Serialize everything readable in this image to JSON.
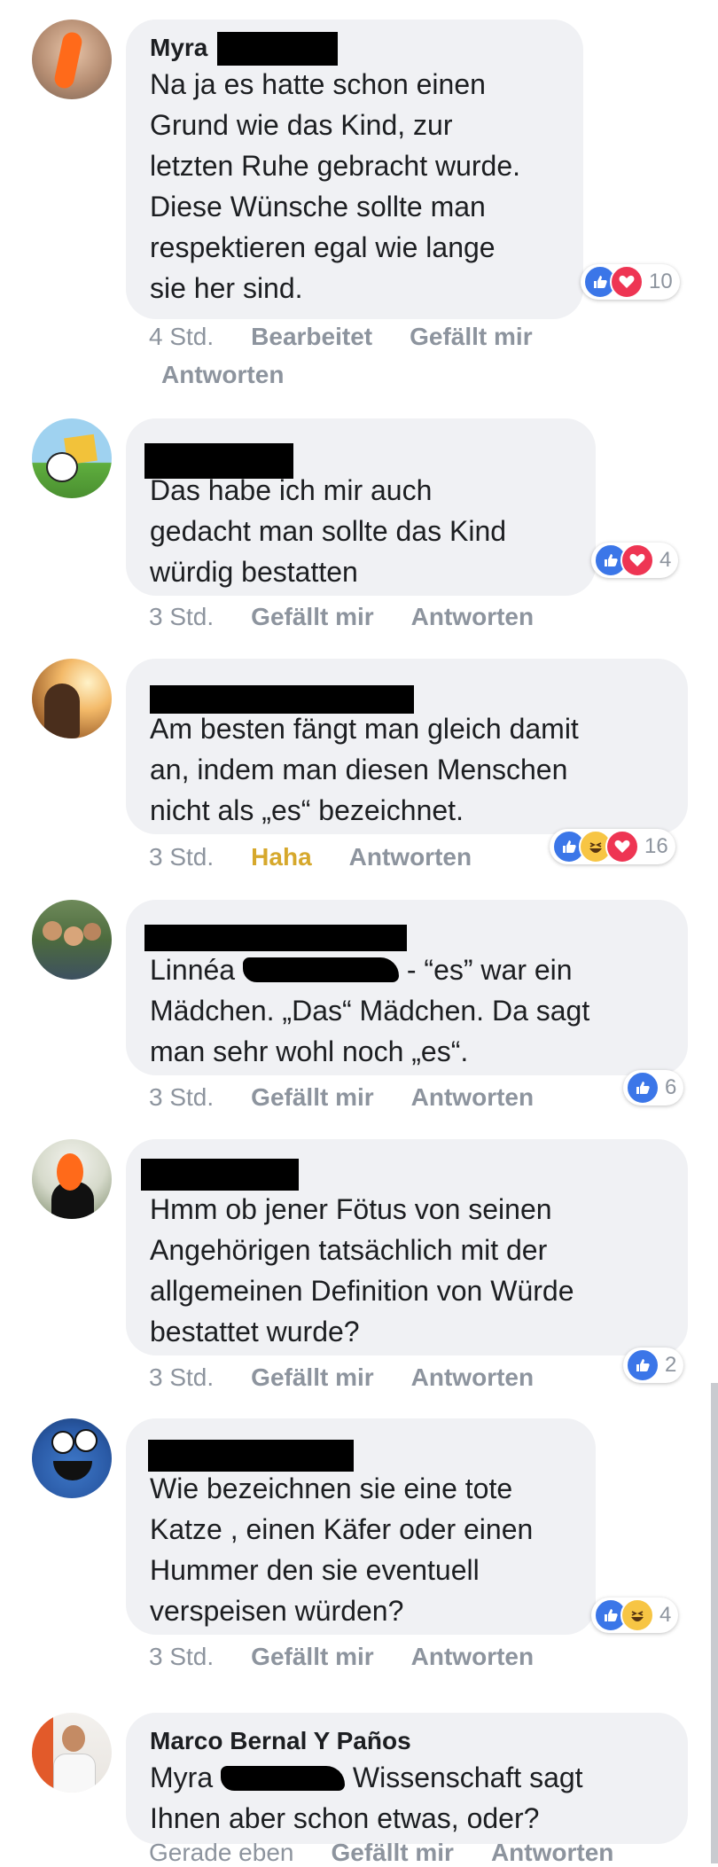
{
  "comments": [
    {
      "author": "Myra",
      "text_lines": [
        "Na ja es hatte schon einen",
        "Grund wie das Kind, zur",
        "letzten Ruhe gebracht wurde.",
        "Diese Wünsche sollte man",
        "respektieren egal wie lange",
        "sie her sind."
      ],
      "time": "4 Std.",
      "edited": "Bearbeitet",
      "like": "Gefällt mir",
      "reply": "Antworten",
      "reaction_count": "10",
      "reactions": [
        "like-icon",
        "love-icon"
      ]
    },
    {
      "author": "",
      "text_lines": [
        "Das habe ich mir auch",
        "gedacht man sollte das Kind",
        "würdig bestatten"
      ],
      "time": "3 Std.",
      "like": "Gefällt mir",
      "reply": "Antworten",
      "reaction_count": "4",
      "reactions": [
        "like-icon",
        "love-icon"
      ]
    },
    {
      "author": "",
      "text_lines": [
        "Am besten fängt man gleich damit",
        "an, indem man diesen Menschen",
        "nicht als „es“ bezeichnet."
      ],
      "time": "3 Std.",
      "like": "Haha",
      "reply": "Antworten",
      "reaction_count": "16",
      "reactions": [
        "like-icon",
        "haha-icon",
        "love-icon"
      ]
    },
    {
      "author": "",
      "mention": "Linnéa",
      "text_lines": [
        "- “es” war ein",
        "Mädchen. „Das“ Mädchen. Da sagt",
        "man sehr wohl noch „es“."
      ],
      "time": "3 Std.",
      "like": "Gefällt mir",
      "reply": "Antworten",
      "reaction_count": "6",
      "reactions": [
        "like-icon"
      ]
    },
    {
      "author": "",
      "text_lines": [
        "Hmm ob jener Fötus von seinen",
        "Angehörigen tatsächlich mit der",
        "allgemeinen Definition von Würde",
        "bestattet wurde?"
      ],
      "time": "3 Std.",
      "like": "Gefällt mir",
      "reply": "Antworten",
      "reaction_count": "2",
      "reactions": [
        "like-icon"
      ]
    },
    {
      "author": "",
      "text_lines": [
        "Wie bezeichnen sie eine tote",
        "Katze , einen Käfer oder einen",
        "Hummer den sie eventuell",
        "verspeisen würden?"
      ],
      "time": "3 Std.",
      "like": "Gefällt mir",
      "reply": "Antworten",
      "reaction_count": "4",
      "reactions": [
        "like-icon",
        "haha-icon"
      ]
    },
    {
      "author": "Marco Bernal Y Paños",
      "mention": "Myra",
      "text_lines": [
        "Wissenschaft sagt",
        "Ihnen aber schon etwas, oder?"
      ],
      "time": "Gerade eben",
      "like": "Gefällt mir",
      "reply": "Antworten"
    }
  ],
  "colors": {
    "bubble": "#f0f1f4",
    "like": "#3b76e8",
    "love": "#ee3553",
    "haha": "#f7c544",
    "haha_label": "#d6a82c",
    "meta": "#8d949e"
  }
}
